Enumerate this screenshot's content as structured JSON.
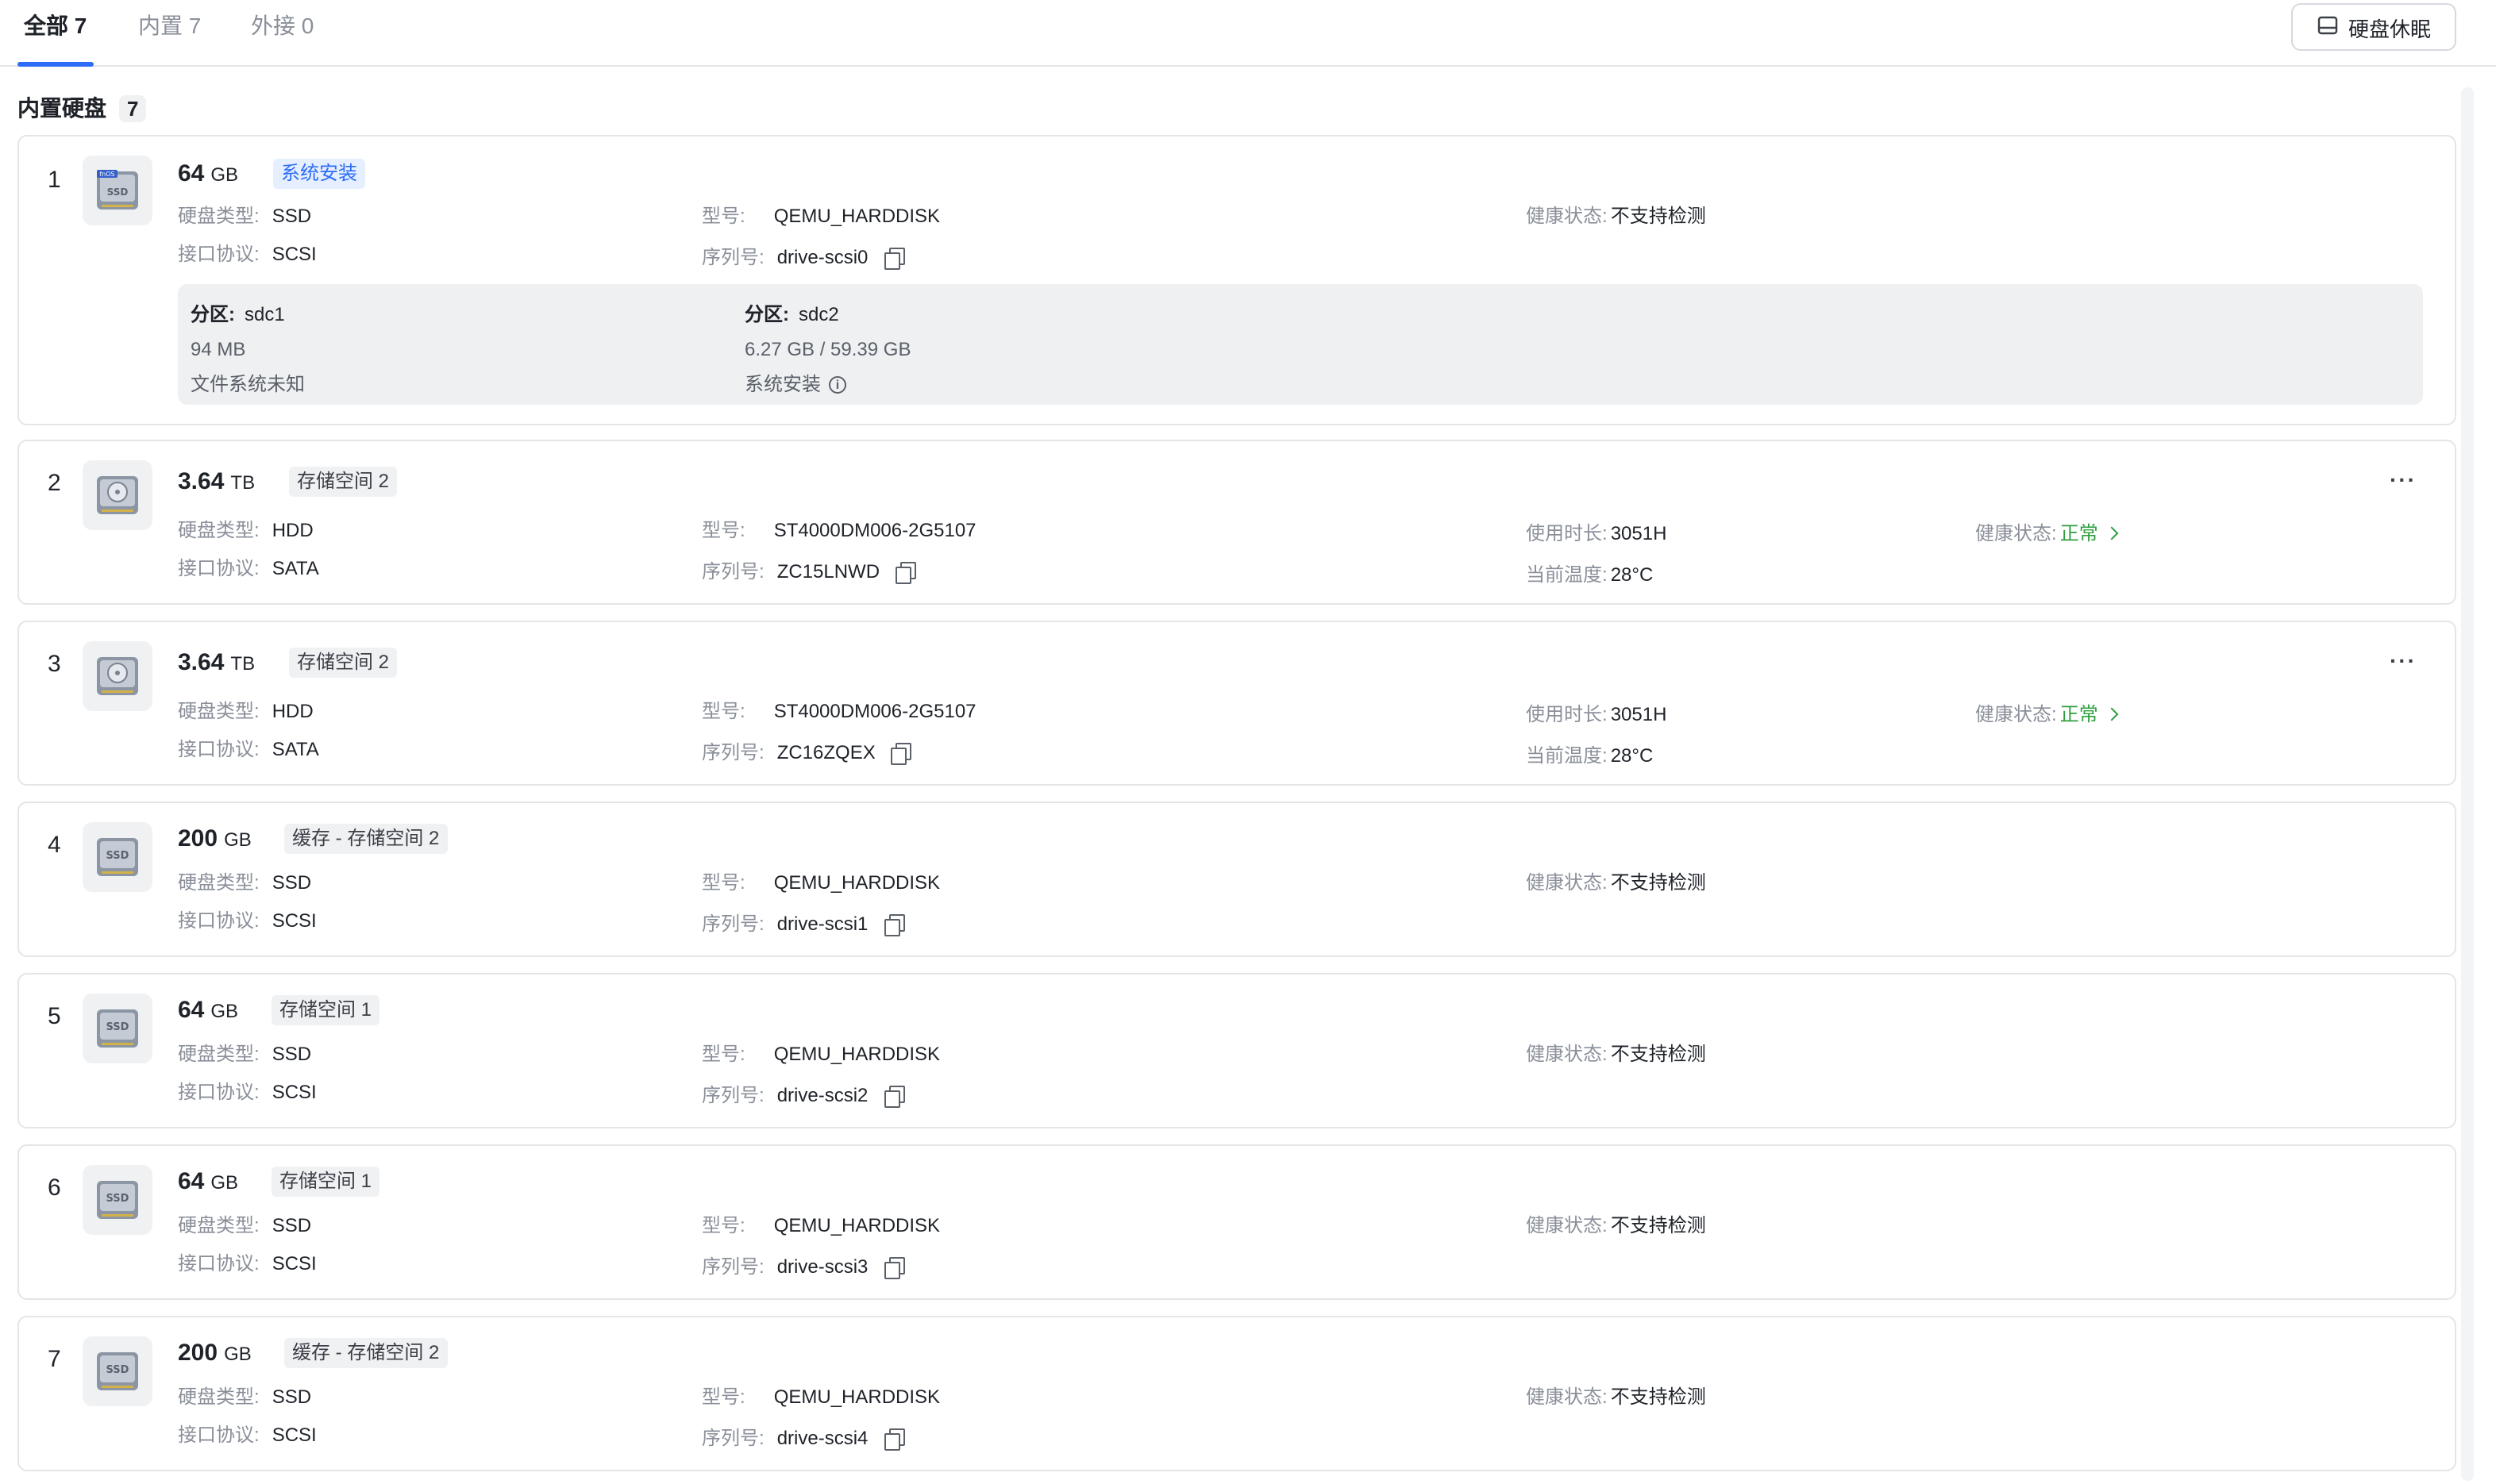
{
  "tabs": [
    {
      "label": "全部 7"
    },
    {
      "label": "内置 7"
    },
    {
      "label": "外接 0"
    }
  ],
  "sleep_button": "硬盘休眠",
  "section": {
    "title": "内置硬盘",
    "count": "7"
  },
  "labels": {
    "disk_type": "硬盘类型:",
    "interface": "接口协议:",
    "model": "型号:",
    "serial": "序列号:",
    "health": "健康状态:",
    "uptime": "使用时长:",
    "temp": "当前温度:",
    "partition": "分区:",
    "more": "···"
  },
  "colors": {
    "accent": "#2d6df6",
    "ok": "#2e9e3f"
  },
  "disks": [
    {
      "index": "1",
      "capacity": "64",
      "unit": "GB",
      "tag": "系统安装",
      "type": "SSD",
      "iface": "SCSI",
      "model": "QEMU_HARDDISK",
      "serial": "drive-scsi0",
      "health": "不支持检测",
      "icon": "fnos-ssd-icon",
      "partitions": [
        {
          "name": "sdc1",
          "size": "94 MB",
          "note": "文件系统未知"
        },
        {
          "name": "sdc2",
          "size": "6.27 GB / 59.39 GB",
          "note": "系统安装"
        }
      ]
    },
    {
      "index": "2",
      "capacity": "3.64",
      "unit": "TB",
      "tag": "存储空间 2",
      "type": "HDD",
      "iface": "SATA",
      "model": "ST4000DM006-2G5107",
      "serial": "ZC15LNWD",
      "uptime": "3051H",
      "temp": "28°C",
      "health": "正常",
      "icon": "hdd-icon"
    },
    {
      "index": "3",
      "capacity": "3.64",
      "unit": "TB",
      "tag": "存储空间 2",
      "type": "HDD",
      "iface": "SATA",
      "model": "ST4000DM006-2G5107",
      "serial": "ZC16ZQEX",
      "uptime": "3051H",
      "temp": "28°C",
      "health": "正常",
      "icon": "hdd-icon"
    },
    {
      "index": "4",
      "capacity": "200",
      "unit": "GB",
      "tag": "缓存 - 存储空间 2",
      "type": "SSD",
      "iface": "SCSI",
      "model": "QEMU_HARDDISK",
      "serial": "drive-scsi1",
      "health": "不支持检测",
      "icon": "ssd-icon"
    },
    {
      "index": "5",
      "capacity": "64",
      "unit": "GB",
      "tag": "存储空间 1",
      "type": "SSD",
      "iface": "SCSI",
      "model": "QEMU_HARDDISK",
      "serial": "drive-scsi2",
      "health": "不支持检测",
      "icon": "ssd-icon"
    },
    {
      "index": "6",
      "capacity": "64",
      "unit": "GB",
      "tag": "存储空间 1",
      "type": "SSD",
      "iface": "SCSI",
      "model": "QEMU_HARDDISK",
      "serial": "drive-scsi3",
      "health": "不支持检测",
      "icon": "ssd-icon"
    },
    {
      "index": "7",
      "capacity": "200",
      "unit": "GB",
      "tag": "缓存 - 存储空间 2",
      "type": "SSD",
      "iface": "SCSI",
      "model": "QEMU_HARDDISK",
      "serial": "drive-scsi4",
      "health": "不支持检测",
      "icon": "ssd-icon"
    }
  ]
}
